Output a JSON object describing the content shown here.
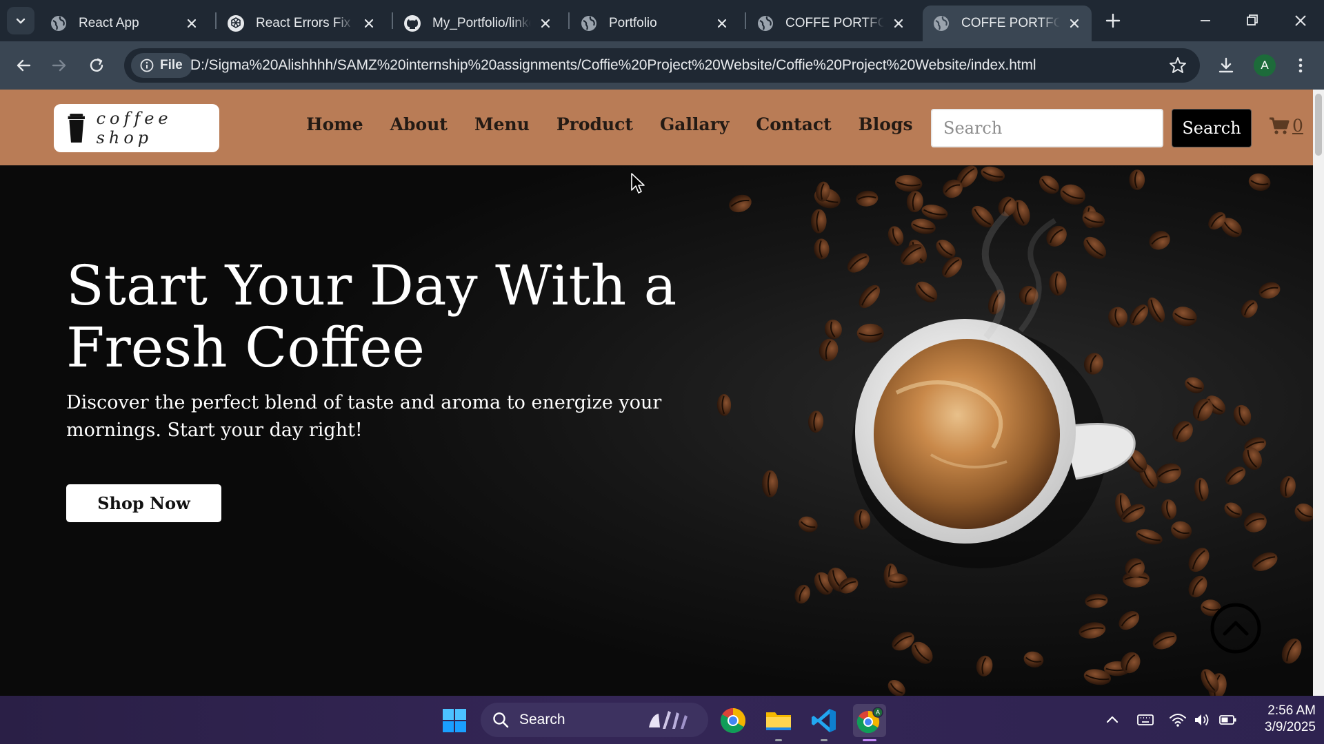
{
  "browser": {
    "tabs": [
      {
        "title": "React App",
        "favicon": "globe-icon",
        "active": false
      },
      {
        "title": "React Errors Fix",
        "favicon": "chatgpt-icon",
        "active": false
      },
      {
        "title": "My_Portfolio/linkedin",
        "favicon": "github-icon",
        "active": false
      },
      {
        "title": "Portfolio",
        "favicon": "globe-icon",
        "active": false
      },
      {
        "title": "COFFE PORTFOLIO",
        "favicon": "globe-icon",
        "active": false
      },
      {
        "title": "COFFE PORTFOLIO",
        "favicon": "globe-icon",
        "active": true
      }
    ],
    "file_chip": "File",
    "url": "D:/Sigma%20Alishhhh/SAMZ%20internship%20assignments/Coffie%20Project%20Website/Coffie%20Project%20Website/index.html",
    "profile_initial": "A"
  },
  "site": {
    "logo_text": "coffee shop",
    "nav": [
      "Home",
      "About",
      "Menu",
      "Product",
      "Gallary",
      "Contact",
      "Blogs"
    ],
    "search_placeholder": "Search",
    "search_button": "Search",
    "cart_count": "0",
    "hero_title": "Start Your Day With a Fresh Coffee",
    "hero_subtitle": "Discover the perfect blend of taste and aroma to energize your mornings. Start your day right!",
    "cta": "Shop Now",
    "colors": {
      "header_bg": "#b97c56",
      "hero_bg": "#0e0e0e"
    }
  },
  "taskbar": {
    "search_label": "Search",
    "apps": [
      "windows-start-icon",
      "chrome-icon",
      "file-explorer-icon",
      "vscode-icon",
      "chrome-profile-icon"
    ],
    "time": "2:56 AM",
    "date": "3/9/2025"
  }
}
